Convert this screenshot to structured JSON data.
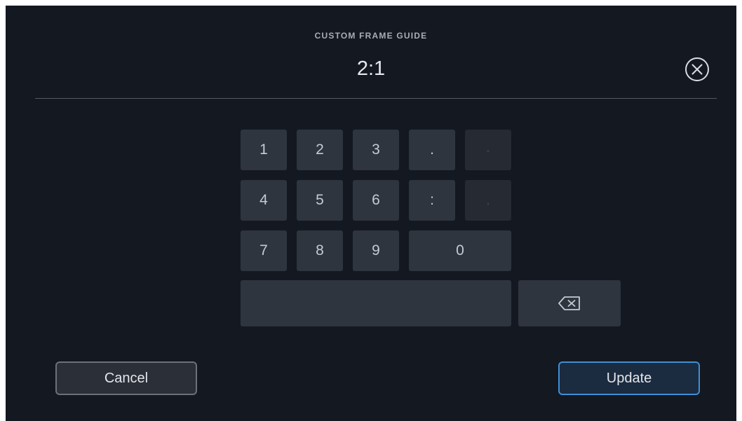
{
  "dialog": {
    "title": "CUSTOM FRAME GUIDE",
    "value": "2:1",
    "close_icon": "circle-x-icon"
  },
  "keypad": {
    "row1": [
      "1",
      "2",
      "3",
      ".",
      "-"
    ],
    "row2": [
      "4",
      "5",
      "6",
      ":",
      ","
    ],
    "row3": [
      "7",
      "8",
      "9",
      "0"
    ],
    "disabled_keys": [
      "-",
      ","
    ],
    "backspace_icon": "backspace-icon"
  },
  "actions": {
    "cancel_label": "Cancel",
    "update_label": "Update"
  },
  "colors": {
    "background": "#141820",
    "key": "#2f353f",
    "accent": "#3d8fd6"
  }
}
